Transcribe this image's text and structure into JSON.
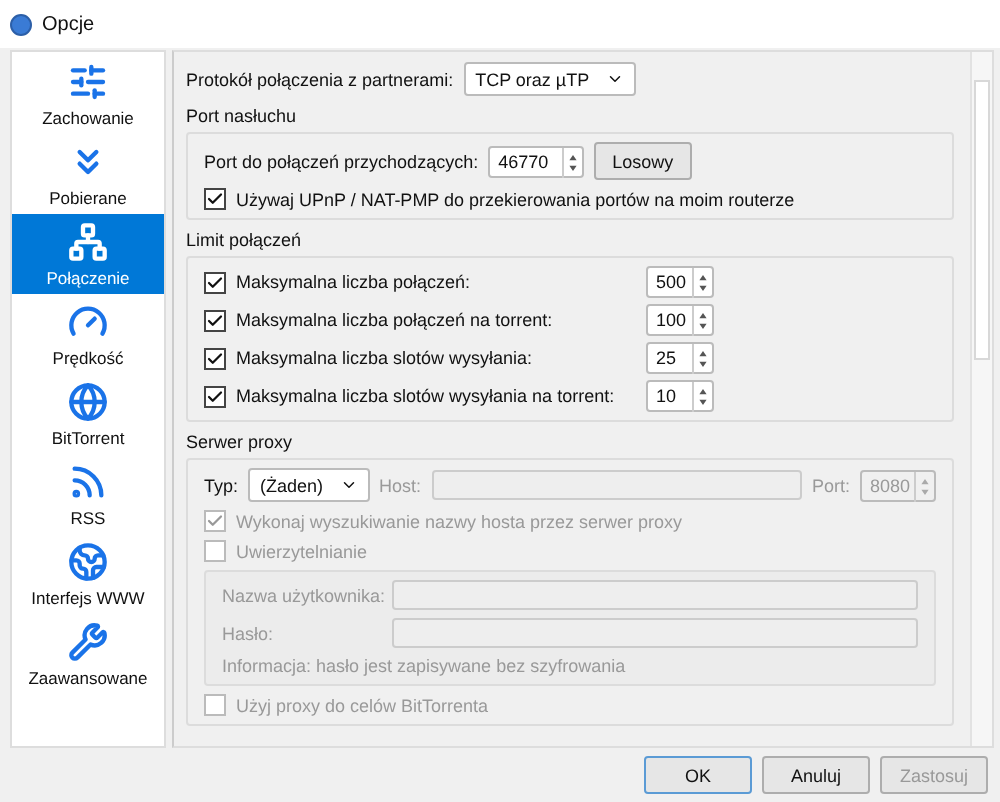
{
  "window": {
    "title": "Opcje"
  },
  "sidebar": {
    "items": [
      {
        "label": "Zachowanie",
        "selected": false
      },
      {
        "label": "Pobierane",
        "selected": false
      },
      {
        "label": "Połączenie",
        "selected": true
      },
      {
        "label": "Prędkość",
        "selected": false
      },
      {
        "label": "BitTorrent",
        "selected": false
      },
      {
        "label": "RSS",
        "selected": false
      },
      {
        "label": "Interfejs WWW",
        "selected": false
      },
      {
        "label": "Zaawansowane",
        "selected": false
      }
    ]
  },
  "protocol": {
    "label": "Protokół połączenia z partnerami:",
    "value": "TCP oraz µTP"
  },
  "listening_port": {
    "title": "Port nasłuchu",
    "port_label": "Port do połączeń przychodzących:",
    "port_value": "46770",
    "random_button": "Losowy",
    "upnp": {
      "label": "Używaj UPnP / NAT-PMP do przekierowania portów na moim routerze",
      "checked": true
    }
  },
  "connection_limits": {
    "title": "Limit połączeń",
    "rows": [
      {
        "label": "Maksymalna liczba połączeń:",
        "value": "500",
        "checked": true
      },
      {
        "label": "Maksymalna liczba połączeń na torrent:",
        "value": "100",
        "checked": true
      },
      {
        "label": "Maksymalna liczba slotów wysyłania:",
        "value": "25",
        "checked": true
      },
      {
        "label": "Maksymalna liczba slotów wysyłania na torrent:",
        "value": "10",
        "checked": true
      }
    ]
  },
  "proxy": {
    "title": "Serwer proxy",
    "type_label": "Typ:",
    "type_value": "(Żaden)",
    "host_label": "Host:",
    "port_label": "Port:",
    "port_value": "8080",
    "hostname_lookup": {
      "label": "Wykonaj wyszukiwanie nazwy hosta przez serwer proxy",
      "checked": true,
      "disabled": true
    },
    "auth": {
      "label": "Uwierzytelnianie",
      "checked": false,
      "disabled": true
    },
    "username_label": "Nazwa użytkownika:",
    "password_label": "Hasło:",
    "info": "Informacja: hasło jest zapisywane bez szyfrowania",
    "bittorrent_only": {
      "label": "Użyj proxy do celów BitTorrenta",
      "checked": false,
      "disabled": true
    }
  },
  "buttons": [
    {
      "label": "OK",
      "disabled": false,
      "default": true
    },
    {
      "label": "Anuluj",
      "disabled": false,
      "default": false
    },
    {
      "label": "Zastosuj",
      "disabled": true,
      "default": false
    }
  ]
}
